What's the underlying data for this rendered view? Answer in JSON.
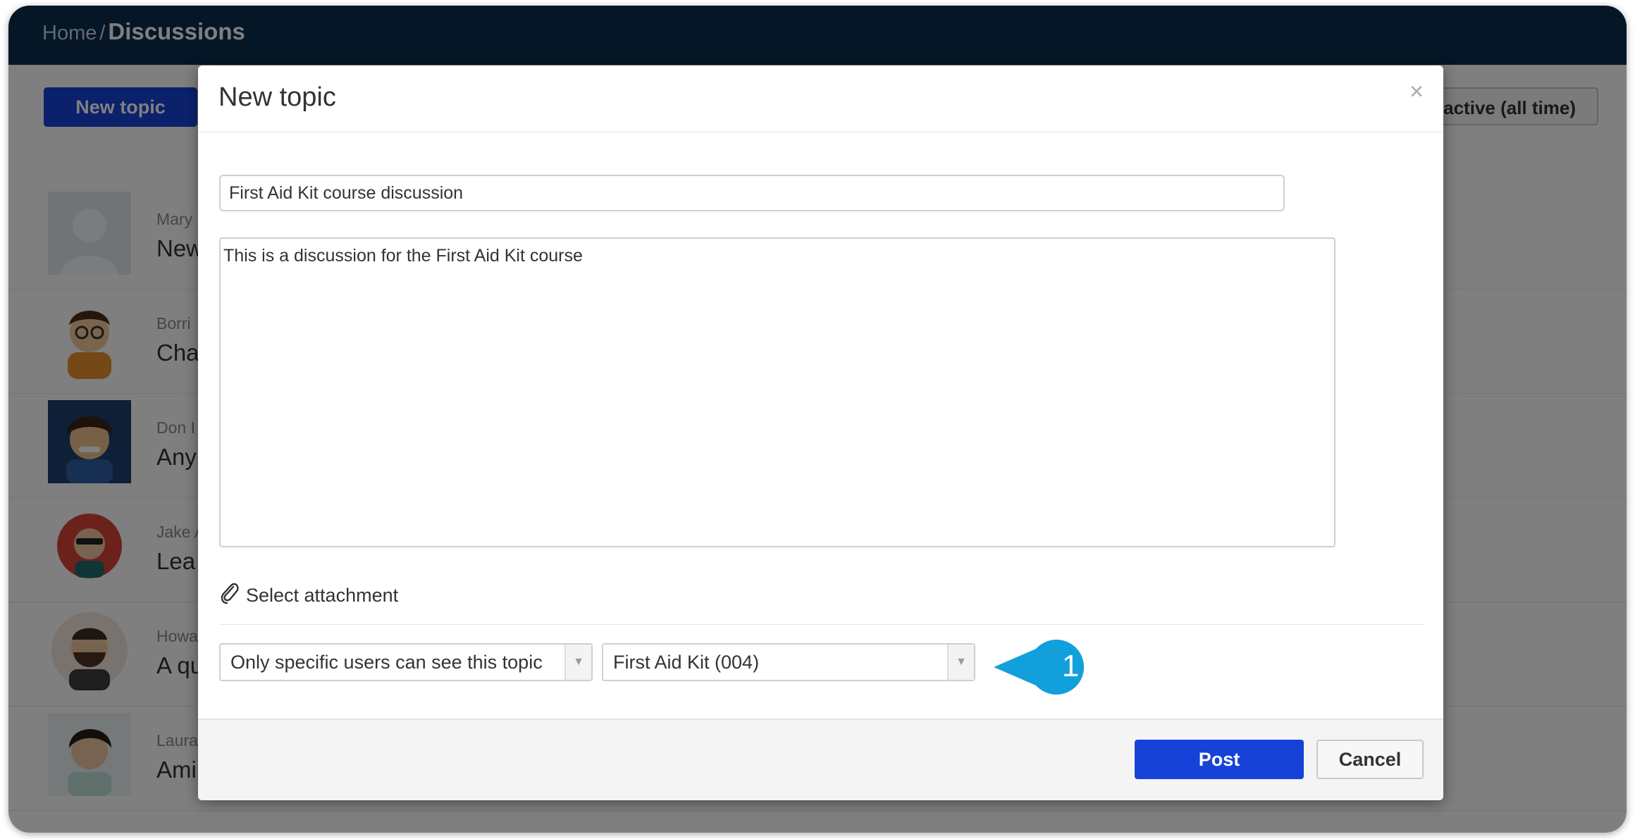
{
  "breadcrumb": {
    "home": "Home",
    "separator": "/",
    "current": "Discussions"
  },
  "toolbar": {
    "new_topic_label": "New topic",
    "filter_label": "active (all time)"
  },
  "topics": [
    {
      "author": "Mary",
      "title": "New"
    },
    {
      "author": "Borri",
      "title": "Cha"
    },
    {
      "author": "Don I",
      "title": "Any"
    },
    {
      "author": "Jake A",
      "title": "Lea"
    },
    {
      "author": "Howa",
      "title": "A qu"
    },
    {
      "author": "Laura",
      "title": "Ami"
    }
  ],
  "modal": {
    "title": "New topic",
    "close_label": "×",
    "subject_value": "First Aid Kit course discussion",
    "body_value": "This is a discussion for the First Aid Kit course",
    "attachment_label": "Select attachment",
    "visibility_value": "Only specific users can see this topic",
    "course_value": "First Aid Kit (004)",
    "post_label": "Post",
    "cancel_label": "Cancel"
  },
  "callout": {
    "number": "1",
    "color": "#12a0dc"
  },
  "colors": {
    "primary": "#1642d8",
    "topbar": "#0b2d4f"
  }
}
